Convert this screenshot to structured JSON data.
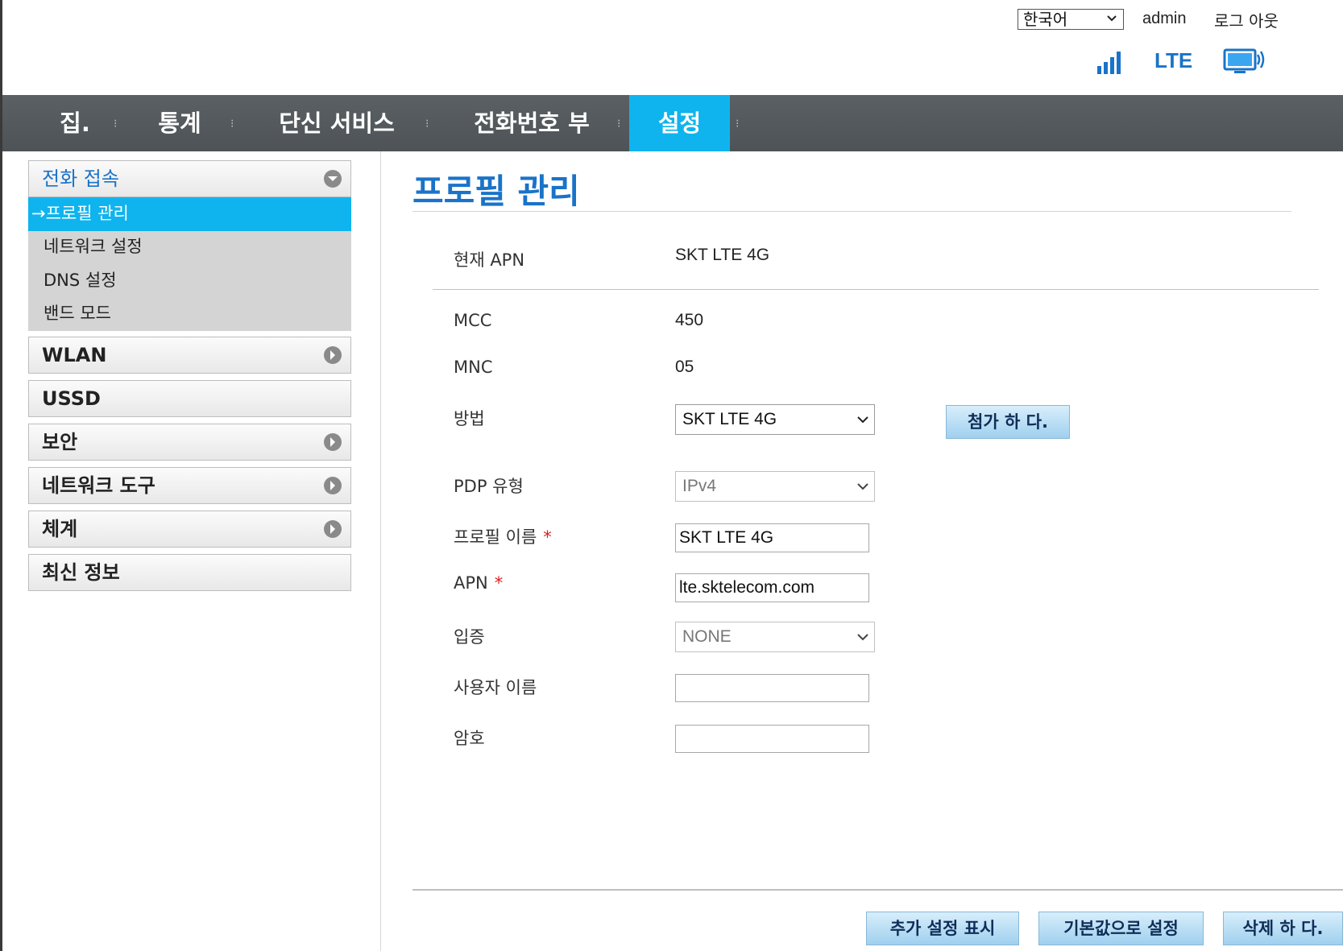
{
  "header": {
    "language": "한국어",
    "user": "admin",
    "logout": "로그 아웃",
    "network_type": "LTE"
  },
  "nav": {
    "items": [
      "집.",
      "통계",
      "단신 서비스",
      "전화번호 부",
      "설정"
    ],
    "active_index": 4
  },
  "sidebar": {
    "groups": [
      {
        "label": "전화 접속",
        "expanded": true,
        "subitems": [
          "→프로필 관리",
          "네트워크 설정",
          "DNS 설정",
          "밴드 모드"
        ]
      },
      {
        "label": "WLAN"
      },
      {
        "label": "USSD"
      },
      {
        "label": "보안"
      },
      {
        "label": "네트워크 도구"
      },
      {
        "label": "체계"
      },
      {
        "label": "최신 정보"
      }
    ]
  },
  "main": {
    "title": "프로필 관리",
    "current_apn_label": "현재 APN",
    "current_apn_value": "SKT LTE 4G",
    "mcc_label": "MCC",
    "mcc_value": "450",
    "mnc_label": "MNC",
    "mnc_value": "05",
    "method_label": "방법",
    "method_value": "SKT LTE 4G",
    "add_button": "첨가 하 다.",
    "pdp_label": "PDP 유형",
    "pdp_value": "IPv4",
    "profile_name_label": "프로필 이름",
    "profile_name_value": "SKT LTE 4G",
    "apn_label": "APN",
    "apn_value": "lte.sktelecom.com",
    "auth_label": "입증",
    "auth_value": "NONE",
    "username_label": "사용자 이름",
    "username_value": "",
    "password_label": "암호",
    "password_value": "",
    "required_mark": "*"
  },
  "footer": {
    "advanced_button": "추가 설정 표시",
    "default_button": "기본값으로 설정",
    "delete_button": "삭제 하 다."
  },
  "colors": {
    "accent": "#0fb4ee",
    "title_blue": "#1a73c8",
    "nav_bg": "#53595c"
  }
}
